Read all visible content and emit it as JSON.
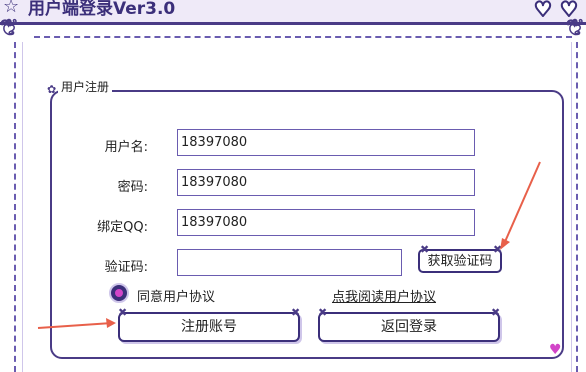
{
  "window": {
    "title": "用户端登录Ver3.0"
  },
  "group": {
    "legend": "用户注册"
  },
  "form": {
    "username": {
      "label": "用户名:",
      "value": "18397080"
    },
    "password": {
      "label": "密码:",
      "value": "18397080"
    },
    "bind_qq": {
      "label": "绑定QQ:",
      "value": "18397080"
    },
    "captcha": {
      "label": "验证码:",
      "value": ""
    },
    "get_captcha_label": "获取验证码"
  },
  "agreement": {
    "agree_label": "同意用户协议",
    "read_link": "点我阅读用户协议"
  },
  "buttons": {
    "register_label": "注册账号",
    "back_label": "返回登录"
  },
  "colors": {
    "frame": "#4a3b86",
    "accent": "#d245c8",
    "arrow": "#e8604a"
  }
}
